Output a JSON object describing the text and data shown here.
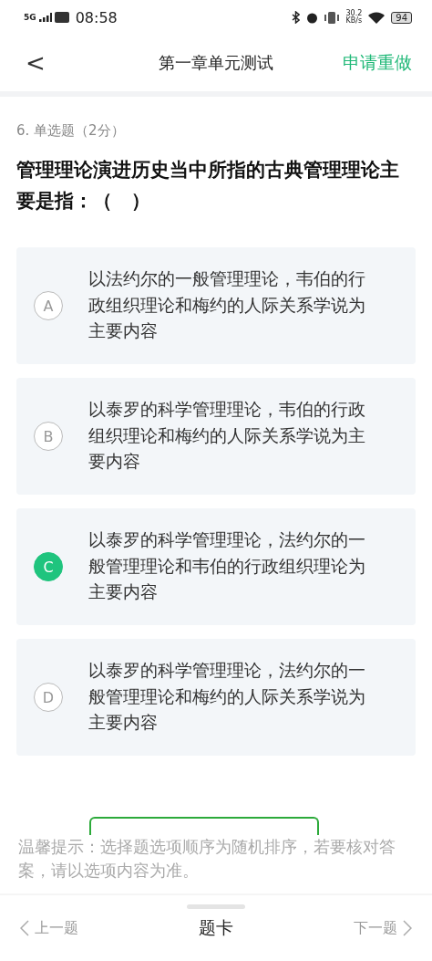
{
  "status_bar": {
    "network": "5G",
    "time": "08:58",
    "speed": "30.2",
    "speed_unit": "KB/s",
    "battery": "94"
  },
  "header": {
    "back": "<",
    "title": "第一章单元测试",
    "action": "申请重做"
  },
  "question": {
    "meta": "6. 单选题（2分）",
    "text": "管理理论演进历史当中所指的古典管理理论主要是指：（　）"
  },
  "options": [
    {
      "letter": "A",
      "text": "以法约尔的一般管理理论，韦伯的行政组织理论和梅约的人际关系学说为主要内容",
      "selected": false
    },
    {
      "letter": "B",
      "text": "以泰罗的科学管理理论，韦伯的行政组织理论和梅约的人际关系学说为主要内容",
      "selected": false
    },
    {
      "letter": "C",
      "text": "以泰罗的科学管理理论，法约尔的一般管理理论和韦伯的行政组织理论为主要内容",
      "selected": true
    },
    {
      "letter": "D",
      "text": "以泰罗的科学管理理论，法约尔的一般管理理论和梅约的人际关系学说为主要内容",
      "selected": false
    }
  ],
  "tip": "温馨提示：选择题选项顺序为随机排序，若要核对答案，请以选项内容为准。",
  "bottom_nav": {
    "prev": "上一题",
    "center": "题卡",
    "next": "下一题"
  }
}
